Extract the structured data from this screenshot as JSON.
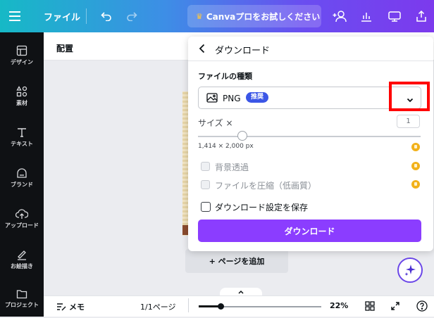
{
  "topbar": {
    "file_label": "ファイル",
    "pro_label": "Canvaプロをお試しください",
    "pro_icon": "crown-icon",
    "colors": {
      "gradient_start": "#16b9c6",
      "gradient_end": "#7c3aed"
    }
  },
  "sidebar": {
    "items": [
      {
        "label": "デザイン",
        "icon": "layout-icon"
      },
      {
        "label": "素材",
        "icon": "elements-icon"
      },
      {
        "label": "テキスト",
        "icon": "text-icon"
      },
      {
        "label": "ブランド",
        "icon": "brand-icon"
      },
      {
        "label": "アップロード",
        "icon": "upload-cloud-icon"
      },
      {
        "label": "お絵描き",
        "icon": "draw-icon"
      },
      {
        "label": "プロジェクト",
        "icon": "folder-icon"
      }
    ]
  },
  "context": {
    "title": "配置"
  },
  "canvas": {
    "add_page_label": "+ ページを追加"
  },
  "download_panel": {
    "back_icon": "chevron-left-icon",
    "title": "ダウンロード",
    "file_type_label": "ファイルの種類",
    "file_type_value": "PNG",
    "file_type_badge": "推奨",
    "size_label": "サイズ ×",
    "size_value": "1",
    "size_slider_level": 0.2,
    "dimensions": "1,414 × 2,000 px",
    "options": [
      {
        "label": "背景透過",
        "checked": false,
        "disabled": true,
        "pro": true
      },
      {
        "label": "ファイルを圧縮（低画質）",
        "checked": false,
        "disabled": true,
        "pro": true
      }
    ],
    "save_settings_label": "ダウンロード設定を保存",
    "save_settings_checked": false,
    "download_button": "ダウンロード",
    "colors": {
      "accent": "#8b3dff",
      "badge": "#3b56e6",
      "pro_coin": "#f2b11a",
      "highlight": "#ff0000"
    }
  },
  "bottombar": {
    "notes_label": "メモ",
    "page_indicator": "1/1ページ",
    "zoom_level_percent": 22,
    "zoom_label": "22%"
  }
}
